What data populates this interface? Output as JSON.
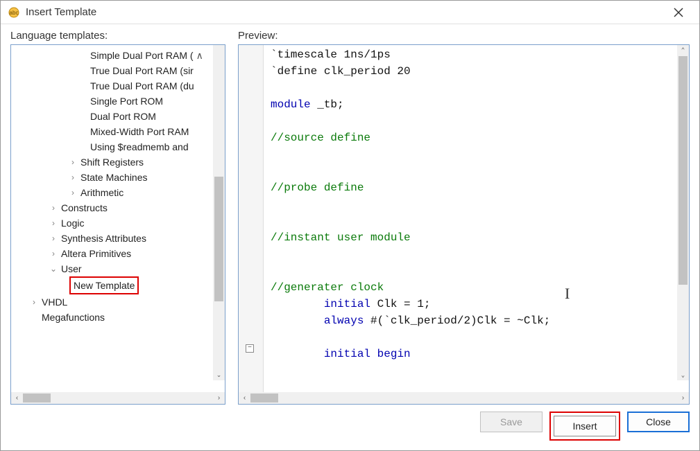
{
  "titlebar": {
    "title": "Insert Template"
  },
  "labels": {
    "language_templates": "Language templates:",
    "preview": "Preview:"
  },
  "tree": {
    "leaves_top": [
      "Simple Dual Port RAM (",
      "True Dual Port RAM (sir",
      "True Dual Port RAM (du",
      "Single Port ROM",
      "Dual Port ROM",
      "Mixed-Width Port RAM",
      "Using $readmemb and "
    ],
    "collapsed_mid": [
      "Shift Registers",
      "State Machines",
      "Arithmetic"
    ],
    "collapsed_low": [
      "Constructs",
      "Logic",
      "Synthesis Attributes",
      "Altera Primitives"
    ],
    "user_label": "User",
    "new_template": "New Template",
    "vhdl": "VHDL",
    "megafunctions": "Megafunctions"
  },
  "code": {
    "l1a": "`timescale 1ns/1ps",
    "l2a": "`define clk_period 20",
    "l4_kw": "module",
    "l4_txt": " _tb;",
    "l6": "//source define",
    "l9": "//probe define",
    "l12": "//instant user module",
    "l15": "//generater clock",
    "l16_kw": "initial",
    "l16_txt": " Clk = 1;",
    "l17_kw": "always",
    "l17_txt": " #(`clk_period/2)Clk = ~Clk;",
    "l19_kw1": "initial",
    "l19_kw2": " begin"
  },
  "buttons": {
    "save": "Save",
    "insert": "Insert",
    "close": "Close"
  }
}
